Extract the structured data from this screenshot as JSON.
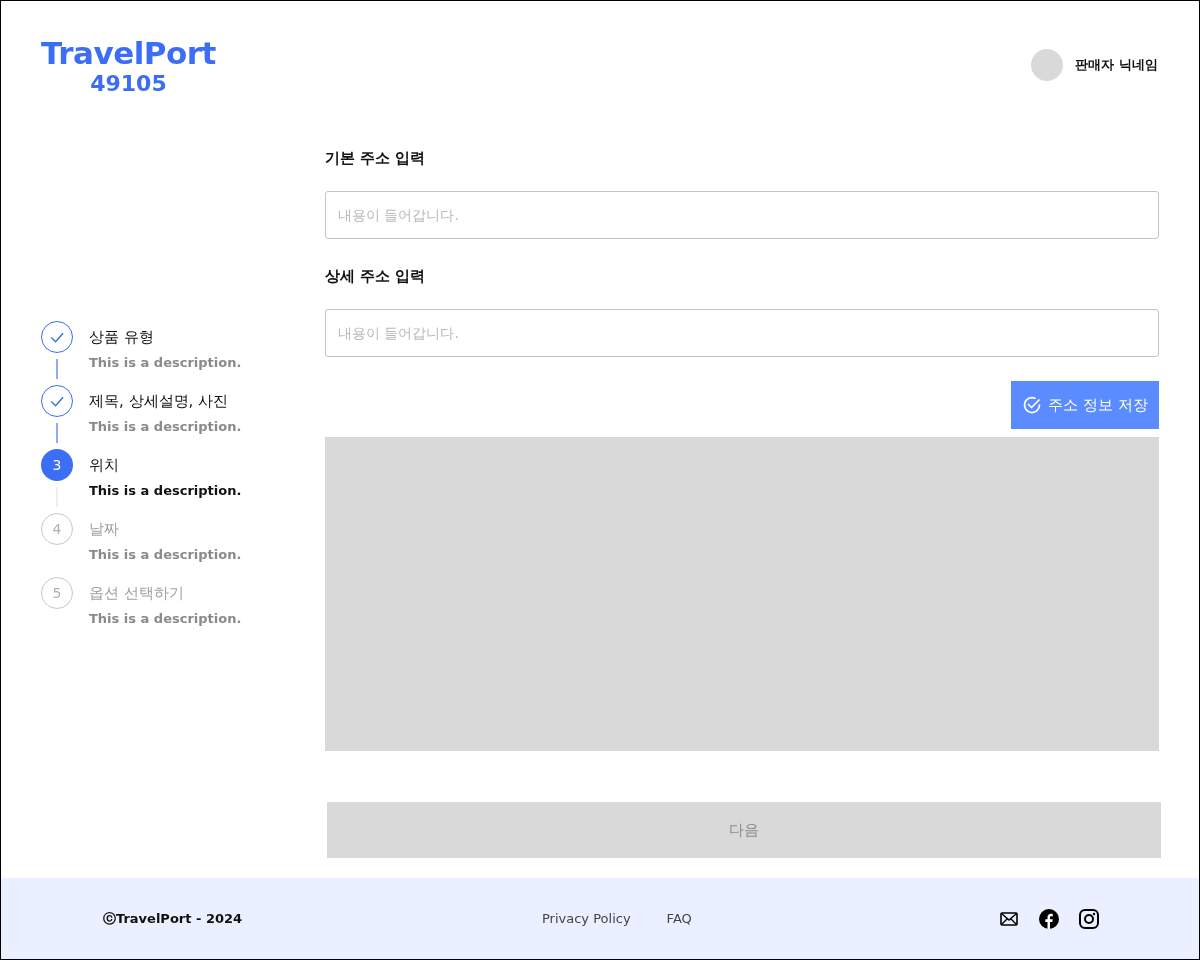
{
  "header": {
    "logo": "TravelPort",
    "logo_code": "49105",
    "user_name": "판매자 닉네임"
  },
  "steps": [
    {
      "title": "상품 유형",
      "description": "This is a description.",
      "completed": true,
      "selected": false
    },
    {
      "title": "제목, 상세설명, 사진",
      "description": "This is a description.",
      "completed": true,
      "selected": false
    },
    {
      "number": "3",
      "title": "위치",
      "description": "This is a description.",
      "completed": false,
      "selected": true
    },
    {
      "number": "4",
      "title": "날짜",
      "description": "This is a description.",
      "completed": false,
      "selected": false
    },
    {
      "number": "5",
      "title": "옵션 선택하기",
      "description": "This is a description.",
      "completed": false,
      "selected": false
    }
  ],
  "form": {
    "fields": [
      {
        "label": "기본 주소 입력",
        "placeholder": "내용이 들어갑니다."
      },
      {
        "label": "상세 주소 입력",
        "placeholder": "내용이 들어갑니다."
      }
    ],
    "save_button": "주소 정보 저장",
    "next_button": {
      "label": "다음",
      "disabled": true
    }
  },
  "footer": {
    "copyright": "ⓒTravelPort - 2024",
    "links": [
      "Privacy Policy",
      "FAQ"
    ]
  }
}
